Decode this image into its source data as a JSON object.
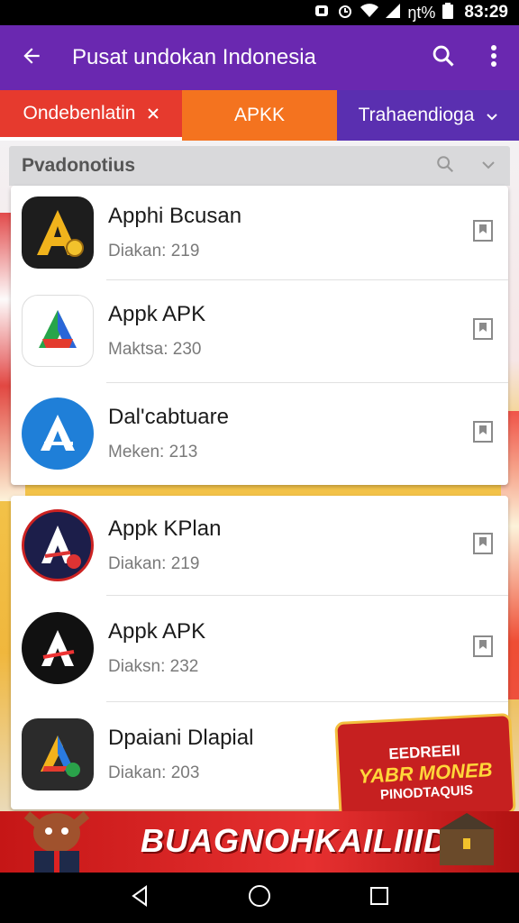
{
  "status_bar": {
    "battery_text": "ŋt%",
    "time": "83:29"
  },
  "app_bar": {
    "title": "Pusat undokan Indonesia",
    "back_icon": "arrow-left-icon",
    "search_icon": "search-icon",
    "menu_icon": "more-vertical-icon"
  },
  "tabs": [
    {
      "label": "Ondebenlatin",
      "icon": "close-icon"
    },
    {
      "label": "APKK"
    },
    {
      "label": "Trahaendioga",
      "icon": "chevron-down-icon"
    }
  ],
  "section": {
    "title": "Pvadonotius"
  },
  "apps": [
    {
      "name": "Apphi Bcusan",
      "meta": "Diakan: 219"
    },
    {
      "name": "Appk APK",
      "meta": "Maktsa: 230"
    },
    {
      "name": "Dal'cabtuare",
      "meta": "Meken: 213"
    },
    {
      "name": "Appk KPlan",
      "meta": "Diakan: 219"
    },
    {
      "name": "Appk APK",
      "meta": "Diaksn: 232"
    },
    {
      "name": "Dpaiani Dlapial",
      "meta": "Diakan: 203"
    }
  ],
  "promo": {
    "line1": "EEDREEII",
    "line2": "YABR MONEB",
    "line3": "PINODTAQUIS"
  },
  "ad": {
    "text": "BUAGNOHKAILIIID"
  },
  "colors": {
    "app_bar": "#6a28b0",
    "tab_red": "#e63a2e",
    "tab_orange": "#f4731f",
    "tab_purple": "#5a2fb0"
  }
}
